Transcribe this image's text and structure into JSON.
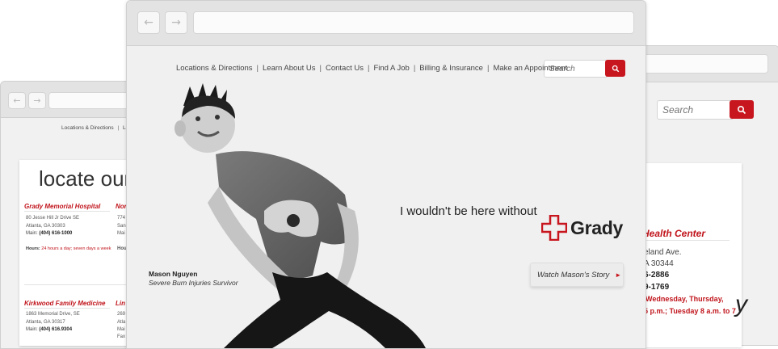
{
  "left_window": {
    "nav_preview": "Locations & Directions",
    "nav_preview_sep": "|",
    "nav_preview_tail": "Le",
    "heading": "locate our",
    "locations": [
      {
        "name": "Grady Memorial Hospital",
        "address": "80 Jesse Hill Jr Drive SE",
        "city": "Atlanta, GA 30303",
        "main_label": "Main:",
        "phone": "(404) 616-1000",
        "hours_label": "Hours:",
        "hours": "24 hours a day; seven days a week"
      },
      {
        "name": "Nor",
        "address": "774",
        "city": "San",
        "main": "Mai",
        "hours": "Hou"
      },
      {
        "name": "Kirkwood Family Medicine",
        "address": "1863 Memorial Drive, SE",
        "city": "Atlanta, GA 30317",
        "main_label": "Main:",
        "phone": "(404) 616.9304"
      },
      {
        "name": "Lin",
        "address": "269",
        "city": "Atla",
        "main": "Mai",
        "fax": "Fax"
      }
    ]
  },
  "center_window": {
    "nav": [
      "Locations & Directions",
      "Learn About Us",
      "Contact Us",
      "Find A Job",
      "Billing & Insurance",
      "Make an Appointment"
    ],
    "search_placeholder": "Search",
    "tagline": "I wouldn't be here without",
    "brand": "Grady",
    "caption_name": "Mason Nguyen",
    "caption_desc": "Severe Burn Injuries Survivor",
    "watch_label": "Watch Mason's Story",
    "watch_arrow": "►"
  },
  "right_window": {
    "nav_tail": "t",
    "search_placeholder": "Search",
    "center_name": "Health Center",
    "address": "eland Ave.",
    "city": "A 30344",
    "phone1": "6-2886",
    "phone2": "9-1769",
    "hours1": "Wednesday, Thursday,",
    "hours2": "5 p.m.; Tuesday 8 a.m. to 7",
    "fragment": "y"
  },
  "colors": {
    "accent": "#c8161e",
    "brand_red": "#c0141b"
  }
}
